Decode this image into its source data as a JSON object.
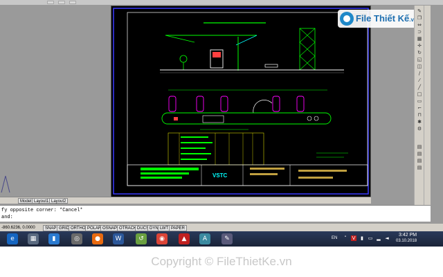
{
  "layout_tabs": [
    "Model",
    "Layout1",
    "Layout2"
  ],
  "command_line": {
    "line1": "fy opposite corner: *Cancel*",
    "line2": "and:"
  },
  "status_bar": {
    "coordinates": "-860.6236, 0.0000",
    "toggles": [
      "SNAP",
      "GRID",
      "ORTHO",
      "POLAR",
      "OSNAP",
      "OTRACK",
      "DUCS",
      "DYN",
      "LWT",
      "PAPER"
    ]
  },
  "taskbar": {
    "language": "EN",
    "time": "3:42 PM",
    "date": "03.10.2018"
  },
  "watermark": {
    "brand": "File Thiết Kế",
    "tld": ".vn",
    "copyright": "Copyright © FileThietKe.vn"
  },
  "drawing": {
    "block_name": "VSTC"
  },
  "colors": {
    "canvas": "#9a9a9a",
    "paper": "#000000",
    "frame_blue": "#3a3aff",
    "green": "#00ff00",
    "magenta": "#ff00ff",
    "cyan": "#00ffff"
  }
}
